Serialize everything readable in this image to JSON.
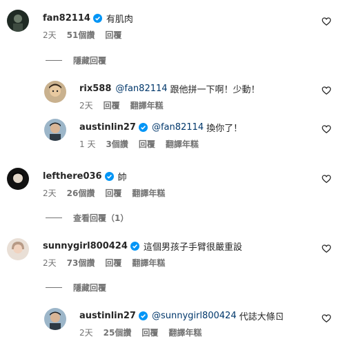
{
  "comments": [
    {
      "username": "fan82114",
      "text": "有肌肉",
      "time": "2天",
      "likes": "51個讚",
      "reply": "回覆",
      "toggle": "隱藏回覆",
      "replies": [
        {
          "username": "rix588",
          "mention": "@fan82114",
          "text": "跟他拼一下啊！少動！",
          "time": "2天",
          "reply": "回覆",
          "translate": "翻譯年糕"
        },
        {
          "username": "austinlin27",
          "mention": "@fan82114",
          "text": "換你了！",
          "time": "1 天",
          "likes": "3個讚",
          "reply": "回覆",
          "translate": "翻譯年糕"
        }
      ]
    },
    {
      "username": "lefthere036",
      "text": "帥",
      "time": "2天",
      "likes": "26個讚",
      "reply": "回覆",
      "translate": "翻譯年糕",
      "toggle": "查看回覆（1）"
    },
    {
      "username": "sunnygirl800424",
      "text": "這個男孩子手臂很嚴重設",
      "time": "2天",
      "likes": "73個讚",
      "reply": "回覆",
      "translate": "翻譯年糕",
      "toggle": "隱藏回覆",
      "replies": [
        {
          "username": "austinlin27",
          "mention": "@sunnygirl800424",
          "text": "代誌大條ㄖ",
          "time": "2天",
          "likes": "25個讚",
          "reply": "回覆",
          "translate": "翻譯年糕"
        }
      ]
    }
  ],
  "colors": {
    "verified": "#0095f6",
    "mention": "#00376b",
    "muted": "#737373"
  },
  "icons": {
    "verified": "verified-badge-icon",
    "like": "heart-outline-icon"
  }
}
